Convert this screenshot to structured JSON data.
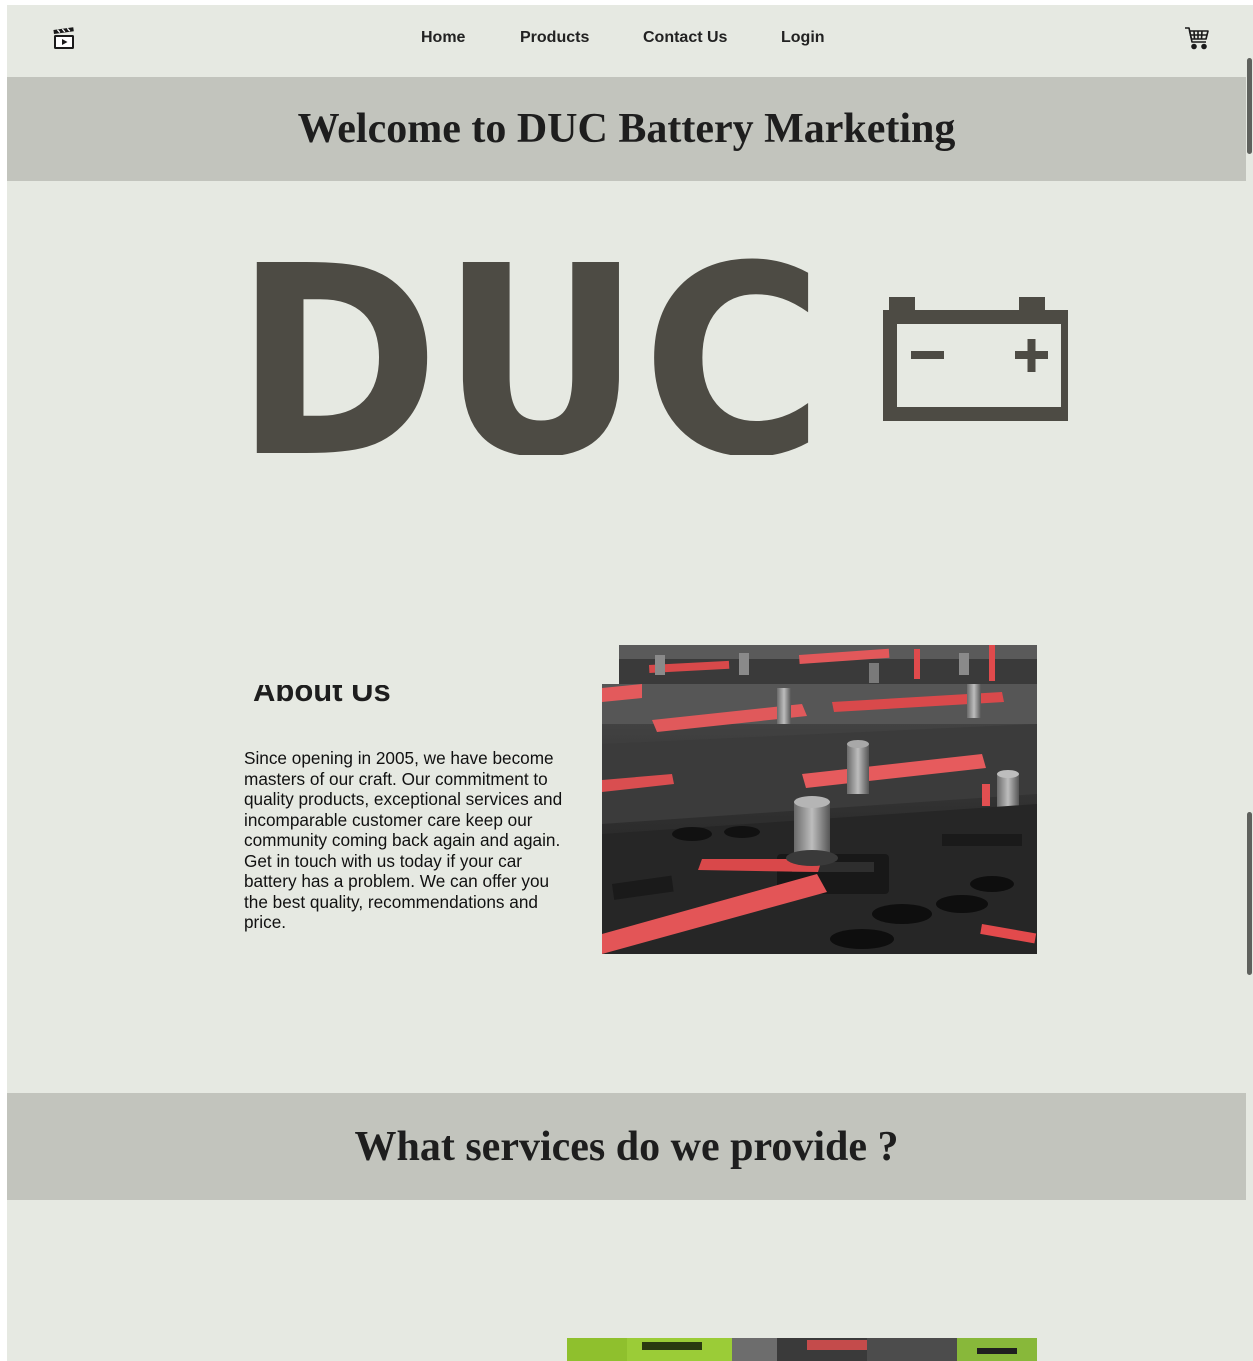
{
  "nav": {
    "links": [
      {
        "label": "Home"
      },
      {
        "label": "Products"
      },
      {
        "label": "Contact Us"
      },
      {
        "label": "Login"
      }
    ],
    "logo_icon": "film-clapper-icon",
    "cart_icon": "shopping-cart-icon"
  },
  "hero": {
    "title": "Welcome to DUC Battery Marketing",
    "logo_text": "DUC",
    "logo_icon": "battery-icon",
    "logo_color": "#4d4b44"
  },
  "about": {
    "heading": "About Us",
    "body": "Since opening in 2005, we have become masters of our craft. Our commitment to quality products, exceptional services and incomparable customer care keep our community coming back again and again. Get in touch with us today if your car battery has a problem. We can offer you the best quality, recommendations and price."
  },
  "services": {
    "title": "What services do we provide ?"
  },
  "colors": {
    "page_background": "#e6e9e2",
    "banner_background": "#c2c4bd",
    "text": "#1e1e1e"
  }
}
